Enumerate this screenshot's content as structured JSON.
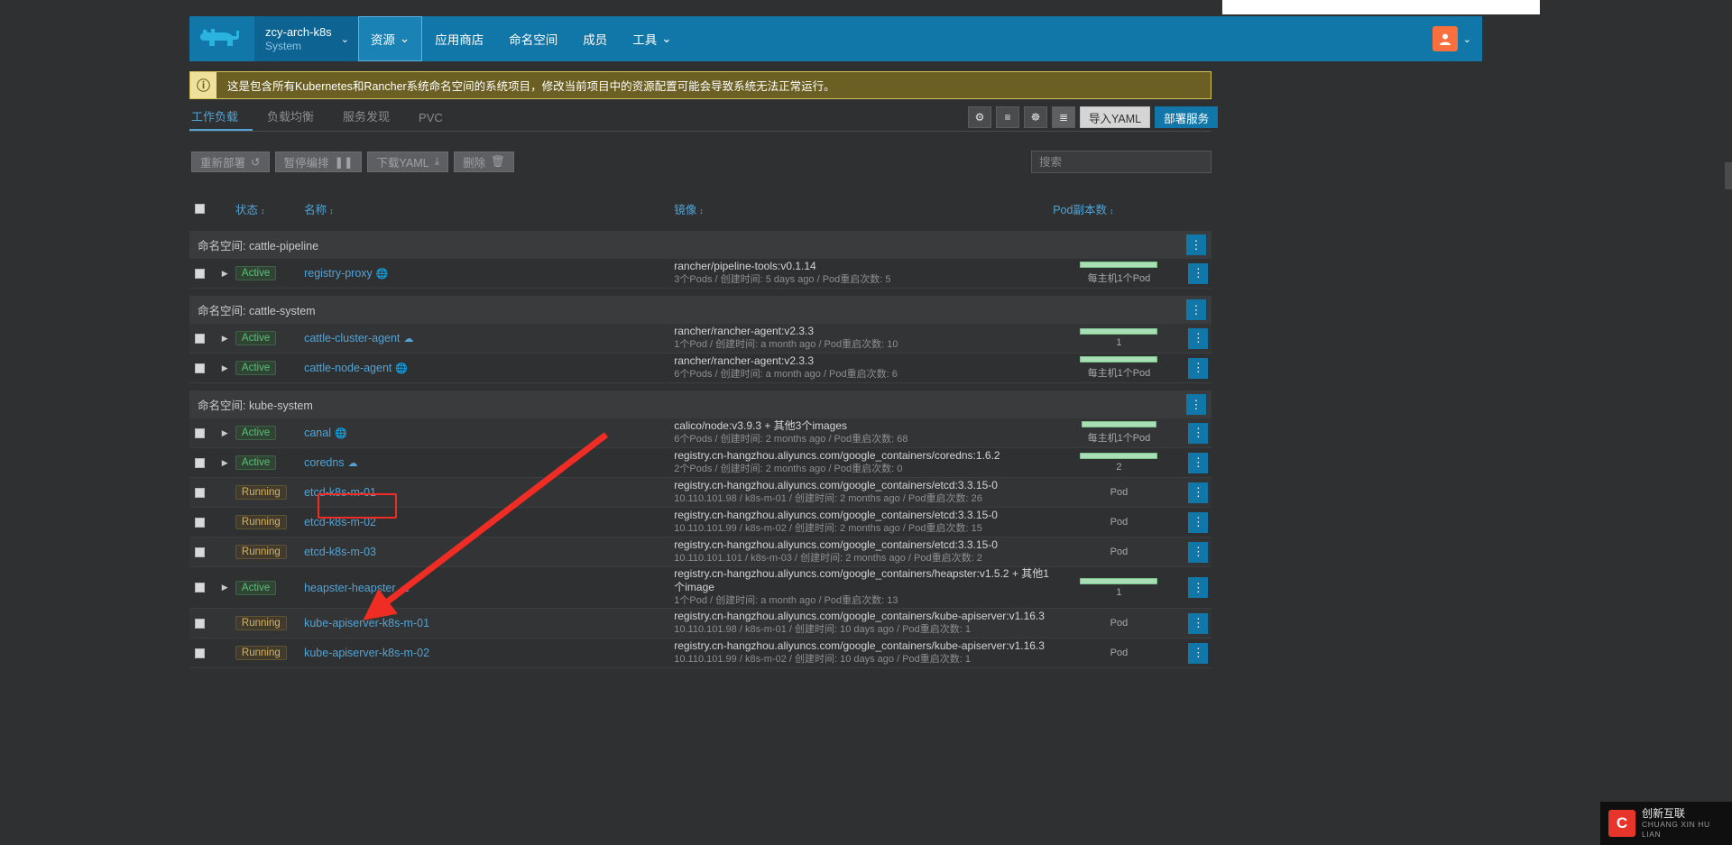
{
  "header": {
    "logo_icon": "rancher-cow-logo",
    "cluster": {
      "name": "zcy-arch-k8s",
      "project": "System",
      "chevron": "⌄"
    },
    "nav": [
      {
        "label": "资源",
        "caret": "⌄",
        "active": true
      },
      {
        "label": "应用商店",
        "caret": "",
        "active": false
      },
      {
        "label": "命名空间",
        "caret": "",
        "active": false
      },
      {
        "label": "成员",
        "caret": "",
        "active": false
      },
      {
        "label": "工具",
        "caret": "⌄",
        "active": false
      }
    ],
    "avatar_icon": "user-avatar-icon",
    "avatar_caret": "⌄",
    "accent_color": "#1176a8",
    "avatar_color": "#f96f3d"
  },
  "banner": {
    "icon": "info-circle-icon",
    "text": "这是包含所有Kubernetes和Rancher系统命名空间的系统项目，修改当前项目中的资源配置可能会导致系统无法正常运行。",
    "bg_color": "#6b5f23",
    "border_color": "#d5c258"
  },
  "tabs": [
    {
      "label": "工作负载",
      "active": true
    },
    {
      "label": "负载均衡",
      "active": false
    },
    {
      "label": "服务发现",
      "active": false
    },
    {
      "label": "PVC",
      "active": false
    }
  ],
  "toolbar": {
    "icon_buttons": [
      {
        "name": "settings-gear-icon",
        "glyph": "⚙",
        "active": false
      },
      {
        "name": "list-view-icon",
        "glyph": "≡",
        "active": false
      },
      {
        "name": "group-view-icon",
        "glyph": "☸",
        "active": false
      },
      {
        "name": "detail-view-icon",
        "glyph": "≣",
        "active": true
      }
    ],
    "import_yaml": "导入YAML",
    "deploy_service": "部署服务"
  },
  "actions": [
    {
      "label": "重新部署",
      "glyph": "↺",
      "name": "redeploy-button"
    },
    {
      "label": "暂停编排",
      "glyph": "❚❚",
      "name": "pause-orchestration-button"
    },
    {
      "label": "下载YAML",
      "glyph": "⤓",
      "name": "download-yaml-button"
    },
    {
      "label": "删除",
      "glyph": "Ὕ1",
      "name": "delete-button"
    }
  ],
  "search": {
    "placeholder": "搜索",
    "value": ""
  },
  "table": {
    "columns": [
      {
        "label": "状态",
        "sortable": true
      },
      {
        "label": "名称",
        "sortable": true
      },
      {
        "label": "镜像",
        "sortable": true
      },
      {
        "label": "Pod副本数",
        "sortable": true
      }
    ],
    "namespace_prefix": "命名空间:",
    "menu_glyph": "⋮",
    "groups": [
      {
        "namespace": "cattle-pipeline",
        "rows": [
          {
            "expandable": true,
            "state": "Active",
            "state_kind": "active",
            "name": "registry-proxy",
            "name_icon": "globe-icon",
            "image": "rancher/pipeline-tools:v0.1.14",
            "meta": "3个Pods / 创建时间: 5 days ago / Pod重启次数: 5",
            "pod_bar": true,
            "pod_fill": 100,
            "pod_label": "每主机1个Pod"
          }
        ]
      },
      {
        "namespace": "cattle-system",
        "rows": [
          {
            "expandable": true,
            "state": "Active",
            "state_kind": "active",
            "name": "cattle-cluster-agent",
            "name_icon": "cloud-icon",
            "image": "rancher/rancher-agent:v2.3.3",
            "meta": "1个Pod / 创建时间: a month ago / Pod重启次数: 10",
            "pod_bar": true,
            "pod_fill": 100,
            "pod_label": "1"
          },
          {
            "expandable": true,
            "state": "Active",
            "state_kind": "active",
            "name": "cattle-node-agent",
            "name_icon": "globe-icon",
            "image": "rancher/rancher-agent:v2.3.3",
            "meta": "6个Pods / 创建时间: a month ago / Pod重启次数: 6",
            "pod_bar": true,
            "pod_fill": 100,
            "pod_label": "每主机1个Pod"
          }
        ]
      },
      {
        "namespace": "kube-system",
        "rows": [
          {
            "expandable": true,
            "state": "Active",
            "state_kind": "active",
            "name": "canal",
            "name_icon": "globe-icon",
            "image": "calico/node:v3.9.3 + 其他3个images",
            "meta": "6个Pods / 创建时间: 2 months ago / Pod重启次数: 68",
            "pod_bar": true,
            "pod_fill": 96,
            "pod_label": "每主机1个Pod"
          },
          {
            "expandable": true,
            "state": "Active",
            "state_kind": "active",
            "name": "coredns",
            "name_icon": "cloud-icon",
            "highlighted": true,
            "image": "registry.cn-hangzhou.aliyuncs.com/google_containers/coredns:1.6.2",
            "meta": "2个Pods / 创建时间: 2 months ago / Pod重启次数: 0",
            "pod_bar": true,
            "pod_fill": 100,
            "pod_label": "2"
          },
          {
            "expandable": false,
            "state": "Running",
            "state_kind": "running",
            "name": "etcd-k8s-m-01",
            "name_icon": "",
            "image": "registry.cn-hangzhou.aliyuncs.com/google_containers/etcd:3.3.15-0",
            "meta": "10.110.101.98 / k8s-m-01 / 创建时间: 2 months ago / Pod重启次数: 26",
            "pod_bar": false,
            "pod_label": "Pod"
          },
          {
            "expandable": false,
            "state": "Running",
            "state_kind": "running",
            "name": "etcd-k8s-m-02",
            "name_icon": "",
            "image": "registry.cn-hangzhou.aliyuncs.com/google_containers/etcd:3.3.15-0",
            "meta": "10.110.101.99 / k8s-m-02 / 创建时间: 2 months ago / Pod重启次数: 15",
            "pod_bar": false,
            "pod_label": "Pod"
          },
          {
            "expandable": false,
            "state": "Running",
            "state_kind": "running",
            "name": "etcd-k8s-m-03",
            "name_icon": "",
            "image": "registry.cn-hangzhou.aliyuncs.com/google_containers/etcd:3.3.15-0",
            "meta": "10.110.101.101 / k8s-m-03 / 创建时间: 2 months ago / Pod重启次数: 2",
            "pod_bar": false,
            "pod_label": "Pod"
          },
          {
            "expandable": true,
            "state": "Active",
            "state_kind": "active",
            "name": "heapster-heapster",
            "name_icon": "cloud-icon",
            "image": "registry.cn-hangzhou.aliyuncs.com/google_containers/heapster:v1.5.2 + 其他1个image",
            "meta": "1个Pod / 创建时间: a month ago / Pod重启次数: 13",
            "pod_bar": true,
            "pod_fill": 100,
            "pod_label": "1"
          },
          {
            "expandable": false,
            "state": "Running",
            "state_kind": "running",
            "name": "kube-apiserver-k8s-m-01",
            "name_icon": "",
            "image": "registry.cn-hangzhou.aliyuncs.com/google_containers/kube-apiserver:v1.16.3",
            "meta": "10.110.101.98 / k8s-m-01 / 创建时间: 10 days ago / Pod重启次数: 1",
            "pod_bar": false,
            "pod_label": "Pod"
          },
          {
            "expandable": false,
            "state": "Running",
            "state_kind": "running",
            "name": "kube-apiserver-k8s-m-02",
            "name_icon": "",
            "image": "registry.cn-hangzhou.aliyuncs.com/google_containers/kube-apiserver:v1.16.3",
            "meta": "10.110.101.99 / k8s-m-02 / 创建时间: 10 days ago / Pod重启次数: 1",
            "pod_bar": false,
            "pod_label": "Pod"
          }
        ]
      }
    ]
  },
  "annotation": {
    "arrow_color": "#ef2d24",
    "highlight_target": "coredns"
  },
  "watermark": {
    "mark": "C",
    "line1": "创新互联",
    "line2": "CHUANG XIN HU LIAN"
  }
}
